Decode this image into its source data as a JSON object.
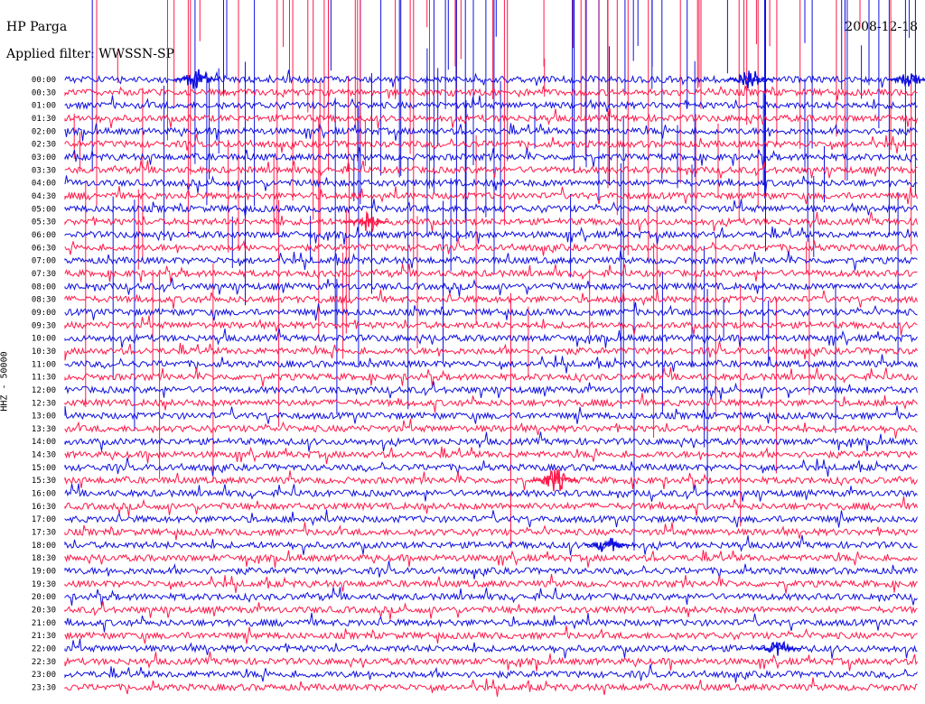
{
  "header": {
    "station": "HP Parga",
    "date": "2008-12-18",
    "filter": "Applied filter: WWSSN-SP"
  },
  "channel_label": "HHZ - 50000",
  "colors": {
    "trace_a": "#1010e0",
    "trace_b": "#ff1a4a",
    "background": "#ffffff"
  },
  "chart_data": {
    "type": "helicorder",
    "rows": [
      "00:00",
      "00:30",
      "01:00",
      "01:30",
      "02:00",
      "02:30",
      "03:00",
      "03:30",
      "04:00",
      "04:30",
      "05:00",
      "05:30",
      "06:00",
      "06:30",
      "07:00",
      "07:30",
      "08:00",
      "08:30",
      "09:00",
      "09:30",
      "10:00",
      "10:30",
      "11:00",
      "11:30",
      "12:00",
      "12:30",
      "13:00",
      "13:30",
      "14:00",
      "14:30",
      "15:00",
      "15:30",
      "16:00",
      "16:30",
      "17:00",
      "17:30",
      "18:00",
      "18:30",
      "19:00",
      "19:30",
      "20:00",
      "20:30",
      "21:00",
      "21:30",
      "22:00",
      "22:30",
      "23:00",
      "23:30"
    ],
    "row_minutes": 30,
    "trace_colors_alternate": [
      "trace_a",
      "trace_b"
    ],
    "grid": false
  }
}
